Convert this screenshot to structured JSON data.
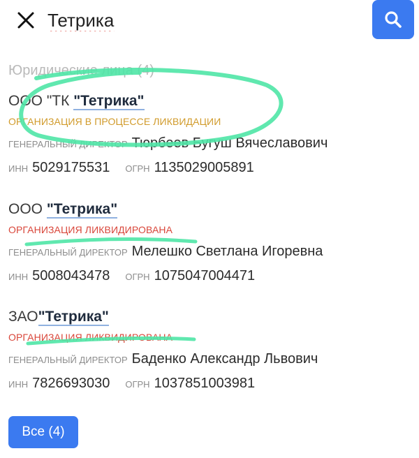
{
  "search": {
    "query": "Тетрика"
  },
  "section_title": "Юридические лица (4)",
  "labels": {
    "director": "ГЕНЕРАЛЬНЫЙ ДИРЕКТОР",
    "inn": "ИНН",
    "ogrn": "ОГРН"
  },
  "orgs": [
    {
      "prefix": "ООО \"ТК ",
      "name": "\"Тетрика\"",
      "status": "ОРГАНИЗАЦИЯ В ПРОЦЕССЕ ЛИКВИДАЦИИ",
      "director": "Тюрбеев Бугуш Вячеславович",
      "inn": "5029175531",
      "ogrn": "1135029005891"
    },
    {
      "prefix": "ООО ",
      "name": "\"Тетрика\"",
      "status": "ОРГАНИЗАЦИЯ ЛИКВИДИРОВАНА",
      "director": "Мелешко Светлана Игоревна",
      "inn": "5008043478",
      "ogrn": "1075047004471"
    },
    {
      "prefix": "ЗАО",
      "name": "\"Тетрика\"",
      "status": "ОРГАНИЗАЦИЯ ЛИКВИДИРОВАНА",
      "director": "Баденко Александр Львович",
      "inn": "7826693030",
      "ogrn": "1037851003981"
    }
  ],
  "all_button": "Все (4)",
  "colors": {
    "accent": "#3b7af0",
    "status_liquidating": "#d19b2b",
    "status_liquidated": "#d9463a",
    "highlighter": "#4fe6a6"
  },
  "icons": {
    "close": "close-icon",
    "search": "search-icon"
  }
}
